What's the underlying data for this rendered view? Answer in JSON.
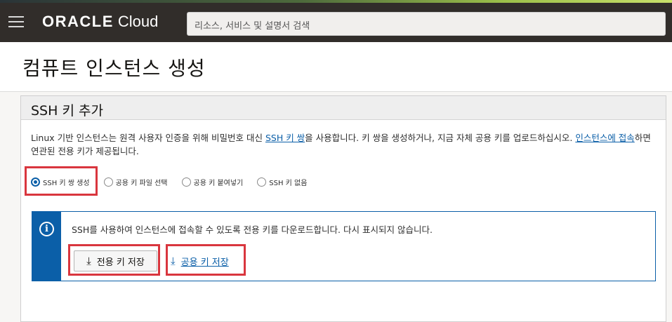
{
  "header": {
    "brand_oracle": "ORACLE",
    "brand_cloud": "Cloud",
    "search_placeholder": "리소스, 서비스 및 설명서 검색"
  },
  "page": {
    "title": "컴퓨트 인스턴스 생성"
  },
  "panel": {
    "title": "SSH 키 추가",
    "desc_part1": "Linux 기반 인스턴스는 원격 사용자 인증을 위해 비밀번호 대신 ",
    "desc_link1": "SSH 키 쌍",
    "desc_part2": "을 사용합니다. 키 쌍을 생성하거나, 지금 자체 공용 키를 업로드하십시오. ",
    "desc_link2": "인스턴스에 접속",
    "desc_part3": "하면 연관된 전용 키가 제공됩니다.",
    "options": [
      {
        "label": "SSH 키 쌍 생성",
        "selected": true
      },
      {
        "label": "공용 키 파일 선택",
        "selected": false
      },
      {
        "label": "공용 키 붙여넣기",
        "selected": false
      },
      {
        "label": "SSH 키 없음",
        "selected": false
      }
    ],
    "info_text": "SSH를 사용하여 인스턴스에 접속할 수 있도록 전용 키를 다운로드합니다. 다시 표시되지 않습니다.",
    "save_private_label": "전용 키 저장",
    "save_public_label": "공용 키 저장"
  },
  "icons": {
    "menu": "hamburger-icon",
    "info": "info-icon",
    "download": "download-icon"
  },
  "colors": {
    "accent": "#0b5fa8",
    "highlight": "#d9363e",
    "topbar": "#312d2a"
  }
}
